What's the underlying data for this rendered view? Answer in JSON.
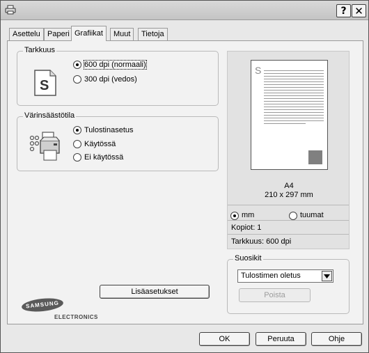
{
  "window": {
    "help_label": "?",
    "close_label": "✕",
    "icon": "printer-icon"
  },
  "tabs": [
    {
      "label": "Asettelu",
      "active": false
    },
    {
      "label": "Paperi",
      "active": false
    },
    {
      "label": "Grafiikat",
      "active": true
    },
    {
      "label": "Muut",
      "active": false
    },
    {
      "label": "Tietoja",
      "active": false
    }
  ],
  "resolution": {
    "title": "Tarkkuus",
    "icon": "samsung-s-document-icon",
    "options": [
      {
        "label": "600 dpi (normaali)",
        "selected": true
      },
      {
        "label": "300 dpi (vedos)",
        "selected": false
      }
    ]
  },
  "toner_save": {
    "title": "Värinsäästötila",
    "icon": "printer-toner-icon",
    "options": [
      {
        "label": "Tulostinasetus",
        "selected": true
      },
      {
        "label": "Käytössä",
        "selected": false
      },
      {
        "label": "Ei käytössä",
        "selected": false
      }
    ]
  },
  "preview": {
    "paper_glyph": "S",
    "paper_size": "A4",
    "paper_dims": "210 x 297 mm",
    "units": [
      {
        "label": "mm",
        "selected": true
      },
      {
        "label": "tuumat",
        "selected": false
      }
    ],
    "copies": "Kopiot: 1",
    "resolution": "Tarkkuus: 600 dpi"
  },
  "favorites": {
    "title": "Suosikit",
    "selected": "Tulostimen oletus",
    "delete_label": "Poista"
  },
  "advanced_button": "Lisäasetukset",
  "logo": {
    "brand": "SAMSUNG",
    "sub": "ELECTRONICS"
  },
  "footer": {
    "ok": "OK",
    "cancel": "Peruuta",
    "help": "Ohje"
  }
}
